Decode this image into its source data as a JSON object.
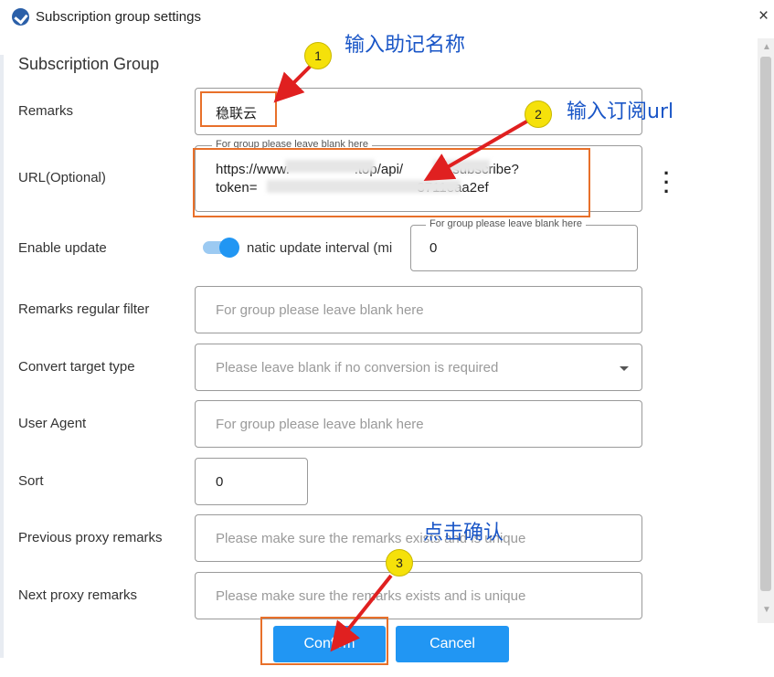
{
  "window": {
    "title": "Subscription group settings",
    "close_glyph": "×"
  },
  "section_title": "Subscription Group",
  "form": {
    "remarks": {
      "label": "Remarks",
      "value": "稳联云"
    },
    "url": {
      "label": "URL(Optional)",
      "legend": "For group please leave blank here",
      "line1": "https://www.                 .top/api/            /subscribe?",
      "line2": "token=                                          3711eaa2ef"
    },
    "enable_update": {
      "label": "Enable update",
      "toggle_on": true,
      "interval_label": "natic update interval (mi",
      "interval_legend": "For group please leave blank here",
      "interval_value": "0"
    },
    "remarks_filter": {
      "label": "Remarks regular filter",
      "placeholder": "For group please leave blank here"
    },
    "convert_target": {
      "label": "Convert target type",
      "placeholder": "Please leave blank if no conversion is required"
    },
    "user_agent": {
      "label": "User Agent",
      "placeholder": "For group please leave blank here"
    },
    "sort": {
      "label": "Sort",
      "value": "0"
    },
    "prev_proxy": {
      "label": "Previous proxy remarks",
      "placeholder": "Please make sure the remarks exists and is unique"
    },
    "next_proxy": {
      "label": "Next proxy remarks",
      "placeholder": "Please make sure the remarks exists and is unique"
    }
  },
  "buttons": {
    "confirm": "Confirm",
    "cancel": "Cancel"
  },
  "annotations": {
    "step1": {
      "num": "1",
      "text": "输入助记名称"
    },
    "step2": {
      "num": "2",
      "text": "输入订阅url"
    },
    "step3": {
      "num": "3",
      "text": "点击确认"
    }
  },
  "colors": {
    "accent": "#2196f3",
    "highlight": "#e8702a",
    "arrow": "#e02020",
    "annotation_text": "#1a56c7",
    "badge": "#f5e10a"
  }
}
